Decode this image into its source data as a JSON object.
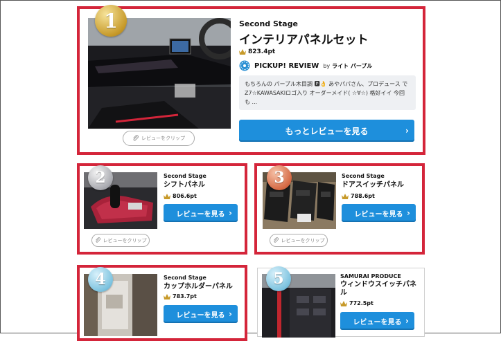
{
  "ranking": [
    {
      "rank": "1",
      "brand": "Second Stage",
      "title": "インテリアパネルセット",
      "score": "823.4pt",
      "pickup": {
        "label": "PICKUP! REVIEW",
        "by": "by",
        "reviewer": "ライト パープル",
        "text": "もちろんの パープル木目調 🅿👌 あやパパさん、プロデュース で Z7☆KAWASAKIロゴ入り オーダーメイド( ☆∀☆) 格好イイ 今回も ..."
      },
      "more_button": "もっとレビューを見る",
      "clip_button": "レビューをクリップ"
    },
    {
      "rank": "2",
      "brand": "Second Stage",
      "title": "シフトパネル",
      "score": "806.6pt",
      "review_button": "レビューを見る",
      "clip_button": "レビューをクリップ"
    },
    {
      "rank": "3",
      "brand": "Second Stage",
      "title": "ドアスイッチパネル",
      "score": "788.6pt",
      "review_button": "レビューを見る",
      "clip_button": "レビューをクリップ"
    },
    {
      "rank": "4",
      "brand": "Second Stage",
      "title": "カップホルダーパネル",
      "score": "783.7pt",
      "review_button": "レビューを見る"
    },
    {
      "rank": "5",
      "brand": "SAMURAI PRODUCE",
      "title": "ウィンドウスイッチパネル",
      "score": "772.5pt",
      "review_button": "レビューを見る"
    }
  ],
  "colors": {
    "accent_red": "#d4253a",
    "button_blue": "#1e8fdc",
    "gold": "#c79a2a"
  },
  "icons": [
    "medal-1-icon",
    "crown-icon",
    "pickup-badge-icon",
    "chevron-right-icon",
    "paperclip-icon"
  ]
}
